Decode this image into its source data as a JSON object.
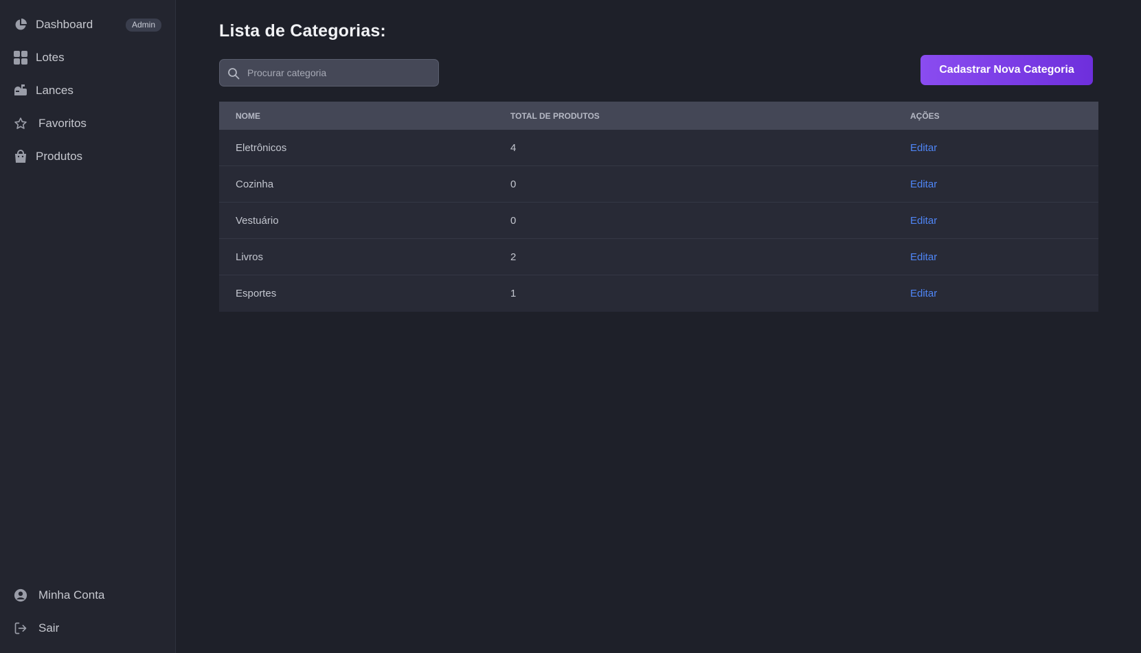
{
  "sidebar": {
    "items": [
      {
        "label": "Dashboard",
        "icon": "chart-pie-icon",
        "badge": "Admin"
      },
      {
        "label": "Lotes",
        "icon": "grid-icon"
      },
      {
        "label": "Lances",
        "icon": "mailbox-icon"
      },
      {
        "label": "Favoritos",
        "icon": "star-icon"
      },
      {
        "label": "Produtos",
        "icon": "shopping-bag-icon"
      }
    ],
    "footer_items": [
      {
        "label": "Minha Conta",
        "icon": "user-circle-icon"
      },
      {
        "label": "Sair",
        "icon": "logout-icon"
      }
    ]
  },
  "main": {
    "title": "Lista de Categorias:",
    "search": {
      "placeholder": "Procurar categoria",
      "value": ""
    },
    "new_category_button": "Cadastrar Nova Categoria",
    "table": {
      "headers": [
        "NOME",
        "TOTAL DE PRODUTOS",
        "AÇÕES"
      ],
      "rows": [
        {
          "name": "Eletrônicos",
          "total": "4",
          "action": "Editar"
        },
        {
          "name": "Cozinha",
          "total": "0",
          "action": "Editar"
        },
        {
          "name": "Vestuário",
          "total": "0",
          "action": "Editar"
        },
        {
          "name": "Livros",
          "total": "2",
          "action": "Editar"
        },
        {
          "name": "Esportes",
          "total": "1",
          "action": "Editar"
        }
      ]
    }
  },
  "colors": {
    "background": "#1e2029",
    "sidebar": "#23252f",
    "accent": "#7c3aed",
    "link": "#4f86f7",
    "table_header": "#444756",
    "table_row": "#282a36"
  }
}
